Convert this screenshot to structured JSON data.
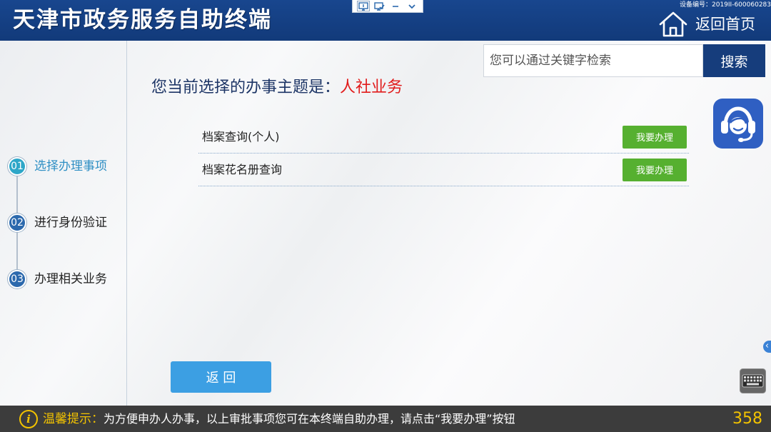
{
  "header": {
    "title": "天津市政务服务自助终端",
    "device_id": "设备编号：2019II-600060283",
    "home_label": "返回首页",
    "home_icon": "home-icon"
  },
  "toolbar": {
    "icons": [
      "monitor-icon",
      "monitor-check-icon",
      "minimize-icon",
      "chevron-down-icon"
    ]
  },
  "search": {
    "placeholder": "您可以通过关键字检索",
    "value": "",
    "button_label": "搜索"
  },
  "steps": [
    {
      "number": "01",
      "label": "选择办理事项",
      "active": true
    },
    {
      "number": "02",
      "label": "进行身份验证",
      "active": false
    },
    {
      "number": "03",
      "label": "办理相关业务",
      "active": false
    }
  ],
  "topic": {
    "prefix": "您当前选择的办事主题是：",
    "name": "人社业务"
  },
  "items": [
    {
      "name": "档案查询(个人)",
      "action_label": "我要办理"
    },
    {
      "name": "档案花名册查询",
      "action_label": "我要办理"
    }
  ],
  "back_button": {
    "label": "返 回"
  },
  "side_tools": {
    "customer_service_icon": "customer-service-icon",
    "collapse_icon": "chevron-left-icon",
    "keyboard_icon": "keyboard-icon"
  },
  "footer": {
    "tip_icon": "info-icon",
    "tip_label": "温馨提示：",
    "tip_text": "为方便申办人办事，以上审批事项您可在本终端自助办理，请点击“我要办理”按钮",
    "countdown": "358"
  },
  "colors": {
    "header_bg": "#123a7a",
    "accent_red": "#e11b1b",
    "action_green": "#56b030",
    "back_blue": "#3c9fe3",
    "step_current": "#2ea7c8",
    "step_pending": "#2c69ad",
    "footer_bg": "#3c3c3c",
    "footer_highlight": "#f3c300",
    "search_button": "#163d7c",
    "service_icon": "#2f5fc2"
  }
}
